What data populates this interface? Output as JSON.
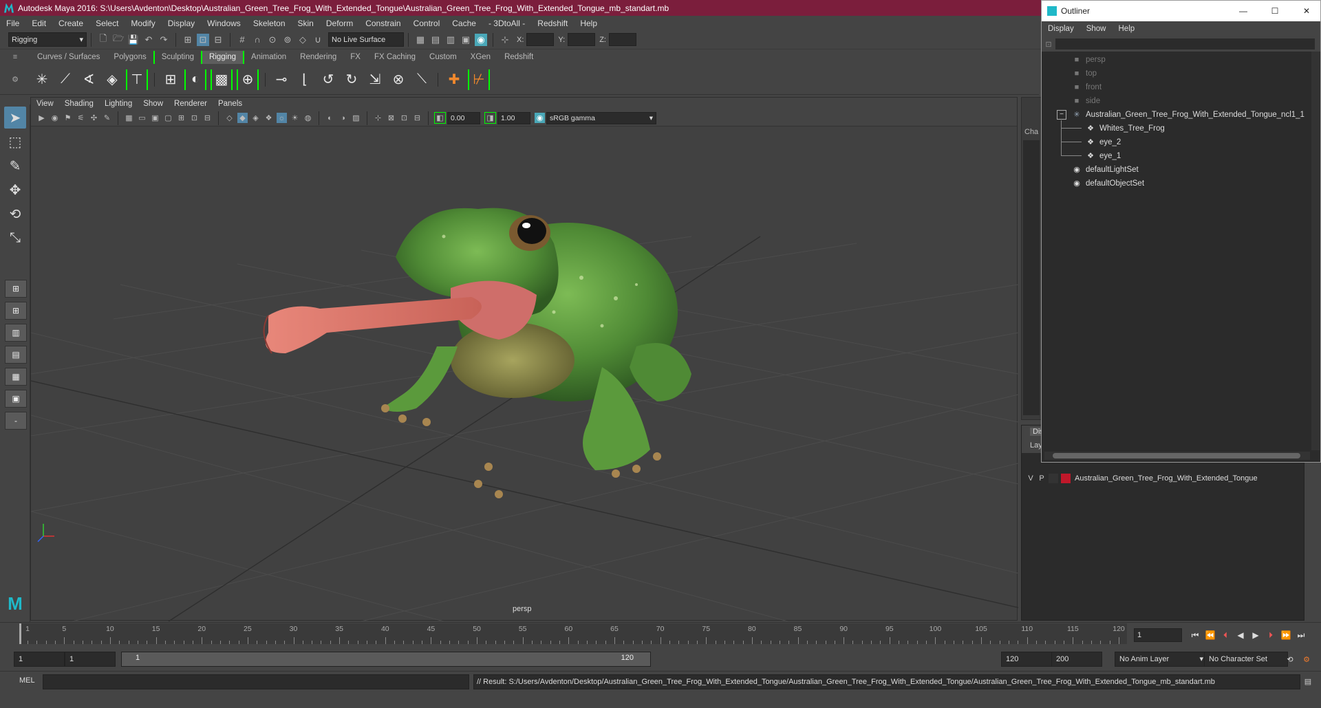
{
  "window": {
    "title": "Autodesk Maya 2016: S:\\Users\\Avdenton\\Desktop\\Australian_Green_Tree_Frog_With_Extended_Tongue\\Australian_Green_Tree_Frog_With_Extended_Tongue_mb_standart.mb"
  },
  "menubar": [
    "File",
    "Edit",
    "Create",
    "Select",
    "Modify",
    "Display",
    "Windows",
    "Skeleton",
    "Skin",
    "Deform",
    "Constrain",
    "Control",
    "Cache",
    "- 3DtoAll -",
    "Redshift",
    "Help"
  ],
  "statusline": {
    "menuset": "Rigging",
    "live_surface": "No Live Surface",
    "x_label": "X:",
    "y_label": "Y:",
    "z_label": "Z:"
  },
  "shelf_tabs": [
    "Curves / Surfaces",
    "Polygons",
    "Sculpting",
    "Rigging",
    "Animation",
    "Rendering",
    "FX",
    "FX Caching",
    "Custom",
    "XGen",
    "Redshift"
  ],
  "shelf_active": "Rigging",
  "viewport": {
    "menus": [
      "View",
      "Shading",
      "Lighting",
      "Show",
      "Renderer",
      "Panels"
    ],
    "near_value": "0.00",
    "far_value": "1.00",
    "color_space": "sRGB gamma",
    "camera": "persp"
  },
  "channel_box": {
    "tab_cha": "Cha",
    "tab_dis": "Dis",
    "tab_lay": "Lay"
  },
  "layer": {
    "v": "V",
    "p": "P",
    "name": "Australian_Green_Tree_Frog_With_Extended_Tongue",
    "color": "#c0182a"
  },
  "outliner": {
    "title": "Outliner",
    "menus": [
      "Display",
      "Show",
      "Help"
    ],
    "items": [
      {
        "label": "persp",
        "dim": true,
        "indent": 0,
        "icon": "camera-icon"
      },
      {
        "label": "top",
        "dim": true,
        "indent": 0,
        "icon": "camera-icon"
      },
      {
        "label": "front",
        "dim": true,
        "indent": 0,
        "icon": "camera-icon"
      },
      {
        "label": "side",
        "dim": true,
        "indent": 0,
        "icon": "camera-icon"
      },
      {
        "label": "Australian_Green_Tree_Frog_With_Extended_Tongue_ncl1_1",
        "dim": false,
        "indent": 0,
        "icon": "joint-icon"
      },
      {
        "label": "Whites_Tree_Frog",
        "dim": false,
        "indent": 1,
        "icon": "mesh-icon"
      },
      {
        "label": "eye_2",
        "dim": false,
        "indent": 1,
        "icon": "mesh-icon"
      },
      {
        "label": "eye_1",
        "dim": false,
        "indent": 1,
        "icon": "mesh-icon"
      },
      {
        "label": "defaultLightSet",
        "dim": false,
        "indent": 0,
        "icon": "set-icon"
      },
      {
        "label": "defaultObjectSet",
        "dim": false,
        "indent": 0,
        "icon": "set-icon"
      }
    ]
  },
  "timeline": {
    "ticks": [
      "1",
      "5",
      "10",
      "15",
      "20",
      "25",
      "30",
      "35",
      "40",
      "45",
      "50",
      "55",
      "60",
      "65",
      "70",
      "75",
      "80",
      "85",
      "90",
      "95",
      "100",
      "105",
      "110",
      "115",
      "120"
    ],
    "current_frame": "1"
  },
  "range": {
    "start": "1",
    "playback_start": "1",
    "slider_start": "1",
    "slider_end": "120",
    "playback_end": "120",
    "end": "200",
    "anim_layer": "No Anim Layer",
    "char_set": "No Character Set"
  },
  "command": {
    "lang": "MEL",
    "result": "// Result: S:/Users/Avdenton/Desktop/Australian_Green_Tree_Frog_With_Extended_Tongue/Australian_Green_Tree_Frog_With_Extended_Tongue/Australian_Green_Tree_Frog_With_Extended_Tongue_mb_standart.mb"
  },
  "colors": {
    "title_bg": "#7b1e3c",
    "accent": "#00ff00",
    "select_blue": "#5285a6"
  }
}
